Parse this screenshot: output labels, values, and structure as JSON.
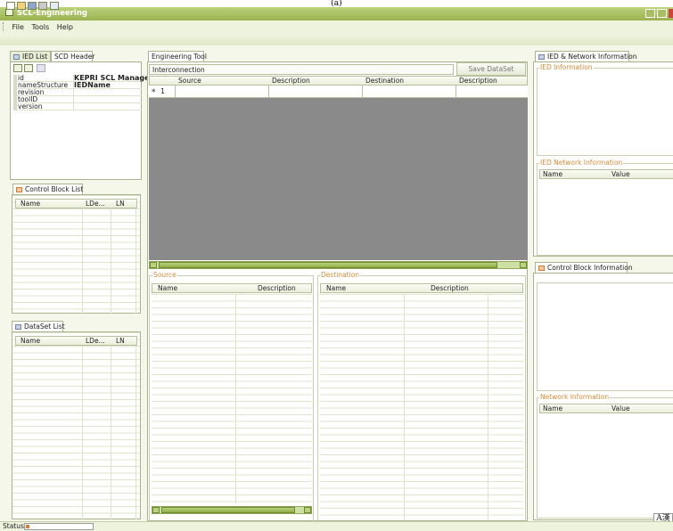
{
  "caption": "(a)",
  "window": {
    "title": "SCL-Engineering"
  },
  "menu": {
    "items": [
      "File",
      "Tools",
      "Help"
    ]
  },
  "left": {
    "tabs": [
      "IED List",
      "SCD Header"
    ],
    "properties": [
      {
        "name": "id",
        "value": "KEPRI SCL Manage"
      },
      {
        "name": "nameStructure",
        "value": "IEDName"
      },
      {
        "name": "revision",
        "value": ""
      },
      {
        "name": "toolID",
        "value": ""
      },
      {
        "name": "version",
        "value": ""
      }
    ],
    "control_block_list": {
      "tab": "Control Block List",
      "columns": [
        "Name",
        "LDe...",
        "LN"
      ]
    },
    "dataset_list": {
      "tab": "DataSet List",
      "columns": [
        "Name",
        "LDe...",
        "LN"
      ]
    }
  },
  "center": {
    "tab": "Engineering Tool",
    "interconnection": "Interconnection",
    "save_button": "Save DataSet",
    "columns": [
      "Source",
      "Description",
      "Destination",
      "Description"
    ],
    "row_marker": "*",
    "row_number": "1",
    "source": {
      "label": "Source",
      "columns": [
        "Name",
        "Description"
      ]
    },
    "destination": {
      "label": "Destination",
      "columns": [
        "Name",
        "Description"
      ]
    }
  },
  "right": {
    "tab": "IED & Network Information",
    "ied_info": "IED Information",
    "ied_network_info": "IED Network Information",
    "value_columns": [
      "Name",
      "Value"
    ],
    "cb_tab": "Control Block Information",
    "network_info": "Network Information",
    "ime_indicator": "A漢"
  },
  "status": {
    "label": "Status"
  }
}
